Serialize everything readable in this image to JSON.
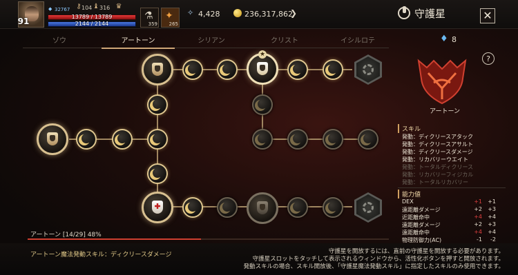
{
  "player": {
    "level": "91",
    "hp": "13789 / 13789",
    "mp": "2144 / 2144",
    "power": "32767"
  },
  "top_stats": [
    {
      "icon": "key-icon",
      "value": "104"
    },
    {
      "icon": "bell-icon",
      "value": "316"
    },
    {
      "icon": "cup-icon",
      "value": ""
    }
  ],
  "slots": [
    {
      "name": "potion-slot",
      "count": "359"
    },
    {
      "name": "scroll-slot",
      "count": "265"
    }
  ],
  "currency": {
    "crystal": "4,428",
    "gold": "236,317,862"
  },
  "header": {
    "title": "守護星",
    "close": "✕"
  },
  "tabs": [
    {
      "label": "ゾウ",
      "active": false
    },
    {
      "label": "アートーン",
      "active": true
    },
    {
      "label": "シリアン",
      "active": false
    },
    {
      "label": "クリスト",
      "active": false
    },
    {
      "label": "イシルロテ",
      "active": false
    }
  ],
  "progress": {
    "label": "アートーン [14/29]  48%",
    "fraction": 0.48
  },
  "bottom": {
    "skill_line": "アートーン魔法発動スキル：ディクリースダメージ",
    "notice_lines": [
      "守護星を開放するには、直前の守護星を開放する必要があります。",
      "守護星スロットをタッチして表示されるウィンドウから、活性化ボタンを押すと開放されます。",
      "発動スキルの場合、スキル開放後、「守護星魔法発動スキル」に指定したスキルのみ使用できます。"
    ]
  },
  "right_panel": {
    "gem_count": "8",
    "help": "?",
    "crest_name": "アートーン",
    "skills_title": "スキル",
    "skills": [
      {
        "text": "発動：ディクリースアタック",
        "active": true
      },
      {
        "text": "発動：ディクリースアサルト",
        "active": true
      },
      {
        "text": "発動：ディクリースダメージ",
        "active": true
      },
      {
        "text": "発動：リカバリーウエイト",
        "active": true
      },
      {
        "text": "発動：トータルディクリース",
        "active": false
      },
      {
        "text": "発動：リカバリーフィジカル",
        "active": false
      },
      {
        "text": "発動：トータルリカバリー",
        "active": false
      }
    ],
    "abilities_title": "能力値",
    "abilities": [
      {
        "name": "DEX",
        "a": "+1",
        "b": "+1",
        "a_red": true
      },
      {
        "name": "遠距離ダメージ",
        "a": "+2",
        "b": "+3",
        "a_red": false
      },
      {
        "name": "近距離命中",
        "a": "+4",
        "b": "+4",
        "a_red": true
      },
      {
        "name": "遠距離ダメージ",
        "a": "+2",
        "b": "+3",
        "a_red": false
      },
      {
        "name": "遠距離命中",
        "a": "+4",
        "b": "+4",
        "a_red": true
      },
      {
        "name": "物理防御力(AC)",
        "a": "-1",
        "b": "-2",
        "a_red": false
      }
    ]
  },
  "colors": {
    "accent_gold": "#d8c090",
    "progress_red": "#d04030",
    "stat_red": "#e04040"
  }
}
